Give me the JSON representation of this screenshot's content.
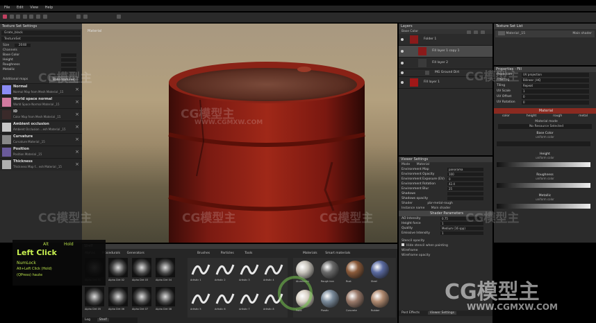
{
  "menu": [
    "File",
    "Edit",
    "View",
    "Help"
  ],
  "texture_settings": {
    "title": "Texture Set Settings",
    "texture_set": "Grate_black",
    "texture_list": "TextureSet",
    "size_label": "Size",
    "size_value": "2048",
    "channels_label": "Channels",
    "channel_rows": [
      "Base Color",
      "Height",
      "Roughness",
      "Metallic"
    ],
    "additional_maps_label": "Additional maps",
    "bake_button": "Bake textures",
    "maps": [
      {
        "name": "Normal",
        "sub": "Normal Map from Mesh Material _15",
        "color": "#8b8cf5"
      },
      {
        "name": "World space normal",
        "sub": "World Space Normal Material _15",
        "color": "#d07aa0"
      },
      {
        "name": "ID",
        "sub": "Color Map from Mesh Material _15",
        "color": "#3a2a2a"
      },
      {
        "name": "Ambient occlusion",
        "sub": "Ambient Occlusion ...esh Material _15",
        "color": "#c8c8c8"
      },
      {
        "name": "Curvature",
        "sub": "Curvature Material _15",
        "color": "#888888"
      },
      {
        "name": "Position",
        "sub": "Position Material _15",
        "color": "#6a5a9a"
      },
      {
        "name": "Thickness",
        "sub": "Thickness Map f... esh Material _15",
        "color": "#b0b0b0"
      }
    ]
  },
  "viewport": {
    "label": "Material"
  },
  "shortcut_overlay": {
    "key1": "Alt",
    "key2": "Hold",
    "action": "Left Click",
    "line2": "NumLock",
    "line3": "Alt+Left Click (Hold)",
    "line4": "(QPress) haute"
  },
  "layers": {
    "title": "Layers",
    "blend_mode": "Base Color",
    "items": [
      {
        "name": "Folder 1",
        "color": "#8a1a1a"
      },
      {
        "name": "Fill layer 1 copy 1",
        "color": "#8a1a1a"
      },
      {
        "name": "Fill layer 2",
        "color": "#3a3a3a"
      },
      {
        "name": "MG Ground Dirt",
        "color": "#4a4a4a"
      },
      {
        "name": "Fill layer 1",
        "color": "#a01818"
      }
    ]
  },
  "texture_set_list": {
    "title": "Texture Set List",
    "item": "Material _15",
    "shader": "Main shader"
  },
  "properties": {
    "title": "Properties - Fill",
    "rows": [
      {
        "label": "Projection",
        "value": "UV projection"
      },
      {
        "label": "Filtering",
        "value": "Bilinear | HQ"
      },
      {
        "label": "Tiling",
        "value": "Repeat"
      },
      {
        "label": "UV Scale",
        "value": "1"
      },
      {
        "label": "UV Offset",
        "value": "0"
      },
      {
        "label": "UV Rotation",
        "value": "0"
      }
    ],
    "material_header": "Material",
    "channels": [
      "color",
      "height",
      "rough",
      "metal"
    ],
    "material_mode": "Material mode",
    "no_resource": "No Resource Selected",
    "sections": [
      {
        "title": "Base Color",
        "sub": "uniform color"
      },
      {
        "title": "Height",
        "sub": "uniform color"
      },
      {
        "title": "Roughness",
        "sub": "uniform color"
      },
      {
        "title": "Metallic",
        "sub": "uniform color"
      }
    ]
  },
  "viewer_settings": {
    "title": "Viewer Settings",
    "mode_label": "Mode",
    "mode_value": "Material",
    "rows": [
      {
        "label": "Environment Map",
        "value": "panorama"
      },
      {
        "label": "Environment Opacity",
        "value": "100"
      },
      {
        "label": "Environment Exposure (EV)",
        "value": "0"
      },
      {
        "label": "Environment Rotation",
        "value": "42.4"
      },
      {
        "label": "Environment Blur",
        "value": "25"
      },
      {
        "label": "Shadows",
        "value": ""
      },
      {
        "label": "Shadows opacity",
        "value": ""
      }
    ],
    "shader_label": "Shader",
    "shader_value": "pbr-metal-rough",
    "instance_label": "Instance name",
    "instance_value": "Main shader",
    "shader_params": "Shader Parameters",
    "params": [
      {
        "label": "AO Intensity",
        "value": "0.75"
      },
      {
        "label": "Height force",
        "value": "1"
      },
      {
        "label": "Quality",
        "value": "Medium (16 spp)"
      },
      {
        "label": "Emissive Intensity",
        "value": "1"
      }
    ],
    "stencil": "Stencil opacity",
    "hide_stencil": "Hide stencil when painting",
    "wireframe": "Wireframe",
    "wireframe_opacity": "Wireframe opacity",
    "tabs": [
      "Post Effects",
      "Viewer Settings"
    ]
  },
  "shelf": {
    "title": "Shelf",
    "tabs": [
      "Alphas",
      "Procedurals",
      "Generators"
    ],
    "brush_tabs": [
      "Brushes",
      "Particles",
      "Tools"
    ],
    "mat_tabs": [
      "Materials",
      "Smart materials"
    ],
    "alpha_labels": [
      "Alpha Dirt 01",
      "Alpha Dirt 02",
      "Alpha Dirt 03",
      "Alpha Dirt 04",
      "Alpha Dirt 05",
      "Alpha Dirt 06",
      "Alpha Dirt 07",
      "Alpha Dirt 08"
    ],
    "brush_labels": [
      "Artistic 1",
      "Artistic 2",
      "Artistic 3",
      "Artistic 4",
      "Artistic 5",
      "Artistic 6",
      "Artistic 7",
      "Artistic 8"
    ],
    "mat_labels": [
      "Aluminium",
      "Rough iron",
      "Rust",
      "Steel",
      "Paint",
      "Plastic",
      "Concrete",
      "Rubber"
    ],
    "bottom_tabs": [
      "Log",
      "Shelf"
    ]
  },
  "watermark": {
    "text": "CG模型主",
    "url": "WWW.CGMXW.COM"
  },
  "colors": {
    "accent": "#b03020",
    "panel": "#2b2b2b",
    "barrel": "#8a1d16"
  }
}
